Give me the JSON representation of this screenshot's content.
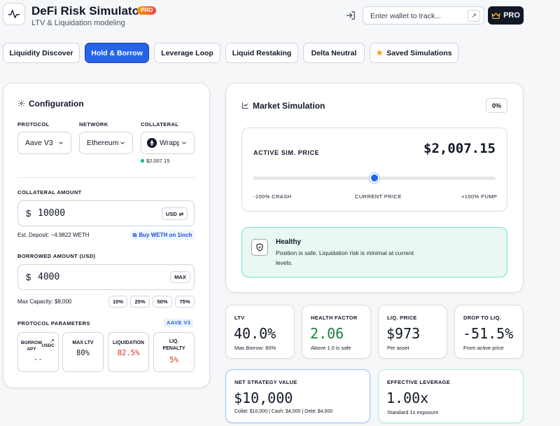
{
  "header": {
    "title": "DeFi Risk Simulator",
    "badge": "PRO",
    "subtitle": "LTV & Liquidation modeling",
    "wallet_placeholder": "Enter wallet to track...",
    "pro_button": "PRO"
  },
  "tabs": [
    {
      "label": "Liquidity Discover"
    },
    {
      "label": "Hold & Borrow"
    },
    {
      "label": "Leverage Loop"
    },
    {
      "label": "Liquid Restaking"
    },
    {
      "label": "Delta Neutral"
    },
    {
      "label": "Saved Simulations"
    }
  ],
  "config": {
    "title": "Configuration",
    "protocol_label": "PROTOCOL",
    "protocol_value": "Aave V3",
    "network_label": "NETWORK",
    "network_value": "Ethereum",
    "collateral_label": "COLLATERAL",
    "collateral_value": "Wrapped Ether",
    "collateral_price": "$2,007.15",
    "collateral_amount_label": "COLLATERAL AMOUNT",
    "currency_symbol": "$",
    "collateral_amount": "10000",
    "unit_toggle": "USD",
    "est_deposit": "Est. Deposit: ~4.9822 WETH",
    "buy_link": "Buy WETH on 1inch",
    "borrowed_label": "BORROWED AMOUNT (USD)",
    "borrowed_amount": "4000",
    "max_button": "MAX",
    "max_capacity": "Max Capacity: $8,000",
    "presets": [
      "10%",
      "25%",
      "50%",
      "75%"
    ],
    "params_label": "PROTOCOL PARAMETERS",
    "params_badge": "AAVE V3",
    "params": [
      {
        "label": "BORROW APY",
        "sub": "USDC",
        "value": "--"
      },
      {
        "label": "MAX LTV",
        "value": "80%"
      },
      {
        "label": "LIQUIDATION",
        "value": "82.5%"
      },
      {
        "label": "LIQ. PENALTY",
        "value": "5%"
      }
    ]
  },
  "market": {
    "title": "Market Simulation",
    "change_badge": "0%",
    "price_label": "ACTIVE SIM. PRICE",
    "price_value": "$2,007.15",
    "slider_position": 0.5,
    "slider_min": "-100% CRASH",
    "slider_mid": "CURRENT PRICE",
    "slider_max": "+100% PUMP",
    "status_title": "Healthy",
    "status_text": "Position is safe. Liquidation risk is minimal at current levels."
  },
  "stats": [
    {
      "label": "LTV",
      "value": "40.0%",
      "sub": "Max Borrow: 80%"
    },
    {
      "label": "HEALTH FACTOR",
      "value": "2.06",
      "sub": "Above 1.0 is safe"
    },
    {
      "label": "LIQ. PRICE",
      "value": "$973",
      "sub": "Per asset"
    },
    {
      "label": "DROP TO LIQ.",
      "value": "-51.5%",
      "sub": "From active price"
    },
    {
      "label": "NET STRATEGY VALUE",
      "value": "$10,000",
      "sub": "Collat: $10,000 | Cash: $4,000 | Debt: $4,000"
    },
    {
      "label": "EFFECTIVE LEVERAGE",
      "value": "1.00x",
      "sub": "Standard 1x exposure"
    }
  ],
  "colors": {
    "accent": "#2563eb",
    "healthy": "#15803d",
    "danger": "#dc2626",
    "healthy_bg": "#e9f8f0",
    "healthy_border": "#6ee7b7"
  }
}
